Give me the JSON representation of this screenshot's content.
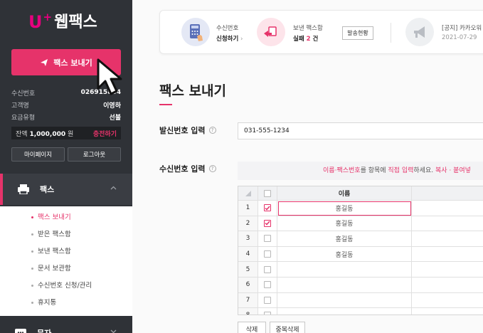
{
  "logo": {
    "brand": "U",
    "plus": "+",
    "name": "웹팩스"
  },
  "send_button": {
    "label": "팩스 보내기"
  },
  "account": {
    "rows": [
      {
        "label": "수신번호",
        "value": "026915834"
      },
      {
        "label": "고객명",
        "value": "이영하"
      },
      {
        "label": "요금유형",
        "value": "선불"
      }
    ],
    "balance_label": "잔액",
    "balance_value": "1,000,000",
    "balance_unit": "원",
    "charge_label": "충전하기"
  },
  "side_buttons": {
    "mypage": "마이페이지",
    "logout": "로그아웃"
  },
  "menu": {
    "fax_label": "팩스",
    "submenu": [
      {
        "label": "팩스 보내기",
        "active": true
      },
      {
        "label": "받은 팩스함"
      },
      {
        "label": "보낸 팩스함"
      },
      {
        "label": "문서 보관함"
      },
      {
        "label": "수신번호 신청/관리"
      },
      {
        "label": "휴지통"
      }
    ],
    "next_label": "문자"
  },
  "summary": {
    "recv_title": "수신번호",
    "recv_action": "신청하기",
    "sent_title": "보낸 팩스함",
    "sent_fail_label": "실패",
    "sent_fail_count": "2",
    "sent_fail_unit": "건",
    "status_button": "발송현황",
    "notice_title": "[공지] 카카오워",
    "notice_date": "2021-07-29"
  },
  "page": {
    "title": "팩스 보내기",
    "sender_label": "발신번호 입력",
    "sender_value": "031-555-1234",
    "recipient_label": "수신번호 입력",
    "hint_pink1": "이름",
    "hint_sep": "·",
    "hint_pink2": "팩스번호",
    "hint_mid": "를 항목에 ",
    "hint_pink3": "직접 입력",
    "hint_mid2": "하세요. ",
    "hint_pink4": "복사 · 붙여넣"
  },
  "grid": {
    "header_name": "이름",
    "rows": [
      {
        "num": "1",
        "checked": true,
        "name": "홍길동"
      },
      {
        "num": "2",
        "checked": true,
        "name": "홍길동"
      },
      {
        "num": "3",
        "checked": false,
        "name": "홍길동"
      },
      {
        "num": "4",
        "checked": false,
        "name": "홍길동"
      },
      {
        "num": "5",
        "checked": false,
        "name": ""
      },
      {
        "num": "6",
        "checked": false,
        "name": ""
      },
      {
        "num": "7",
        "checked": false,
        "name": ""
      },
      {
        "num": "8",
        "checked": false,
        "name": ""
      }
    ]
  },
  "bottom_buttons": {
    "delete": "삭제",
    "dedupe": "중복삭제"
  },
  "colors": {
    "accent": "#e6336a",
    "sidebar": "#2f3237"
  }
}
